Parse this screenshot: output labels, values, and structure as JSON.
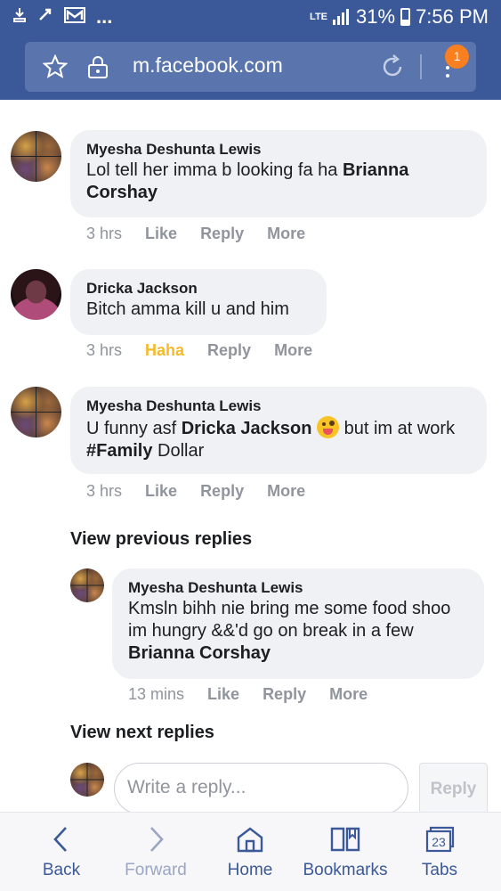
{
  "status_bar": {
    "network": "LTE",
    "battery": "31%",
    "time": "7:56 PM",
    "more": "..."
  },
  "browser": {
    "url": "m.facebook.com",
    "badge_count": "1"
  },
  "comments": [
    {
      "author": "Myesha Deshunta Lewis",
      "text_parts": [
        "Lol tell her imma b looking fa ha ",
        "Brianna Corshay"
      ],
      "time": "3 hrs",
      "like": "Like",
      "reply": "Reply",
      "more": "More"
    },
    {
      "author": "Dricka Jackson",
      "text": "Bitch amma kill u and him",
      "time": "3 hrs",
      "reaction": "Haha",
      "reply": "Reply",
      "more": "More"
    },
    {
      "author": "Myesha Deshunta Lewis",
      "text_parts": [
        "U funny asf ",
        "Dricka Jackson",
        " but im at work ",
        "#Family",
        " Dollar"
      ],
      "emoji": "winking-tongue-emoji",
      "time": "3 hrs",
      "like": "Like",
      "reply": "Reply",
      "more": "More"
    }
  ],
  "view_previous": "View previous replies",
  "reply": {
    "author": "Myesha Deshunta Lewis",
    "text_parts": [
      "Kmsln bihh nie bring me some food shoo im hungry &&'d go on break in a few ",
      "Brianna Corshay"
    ],
    "time": "13 mins",
    "like": "Like",
    "reply": "Reply",
    "more": "More"
  },
  "view_next": "View next replies",
  "composer": {
    "placeholder": "Write a reply...",
    "button": "Reply"
  },
  "bottom_nav": {
    "back": "Back",
    "forward": "Forward",
    "home": "Home",
    "bookmarks": "Bookmarks",
    "tabs": "Tabs",
    "tabs_count": "23"
  },
  "colors": {
    "header": "#3b5998",
    "haha": "#f7b928",
    "badge": "#f97f20"
  }
}
